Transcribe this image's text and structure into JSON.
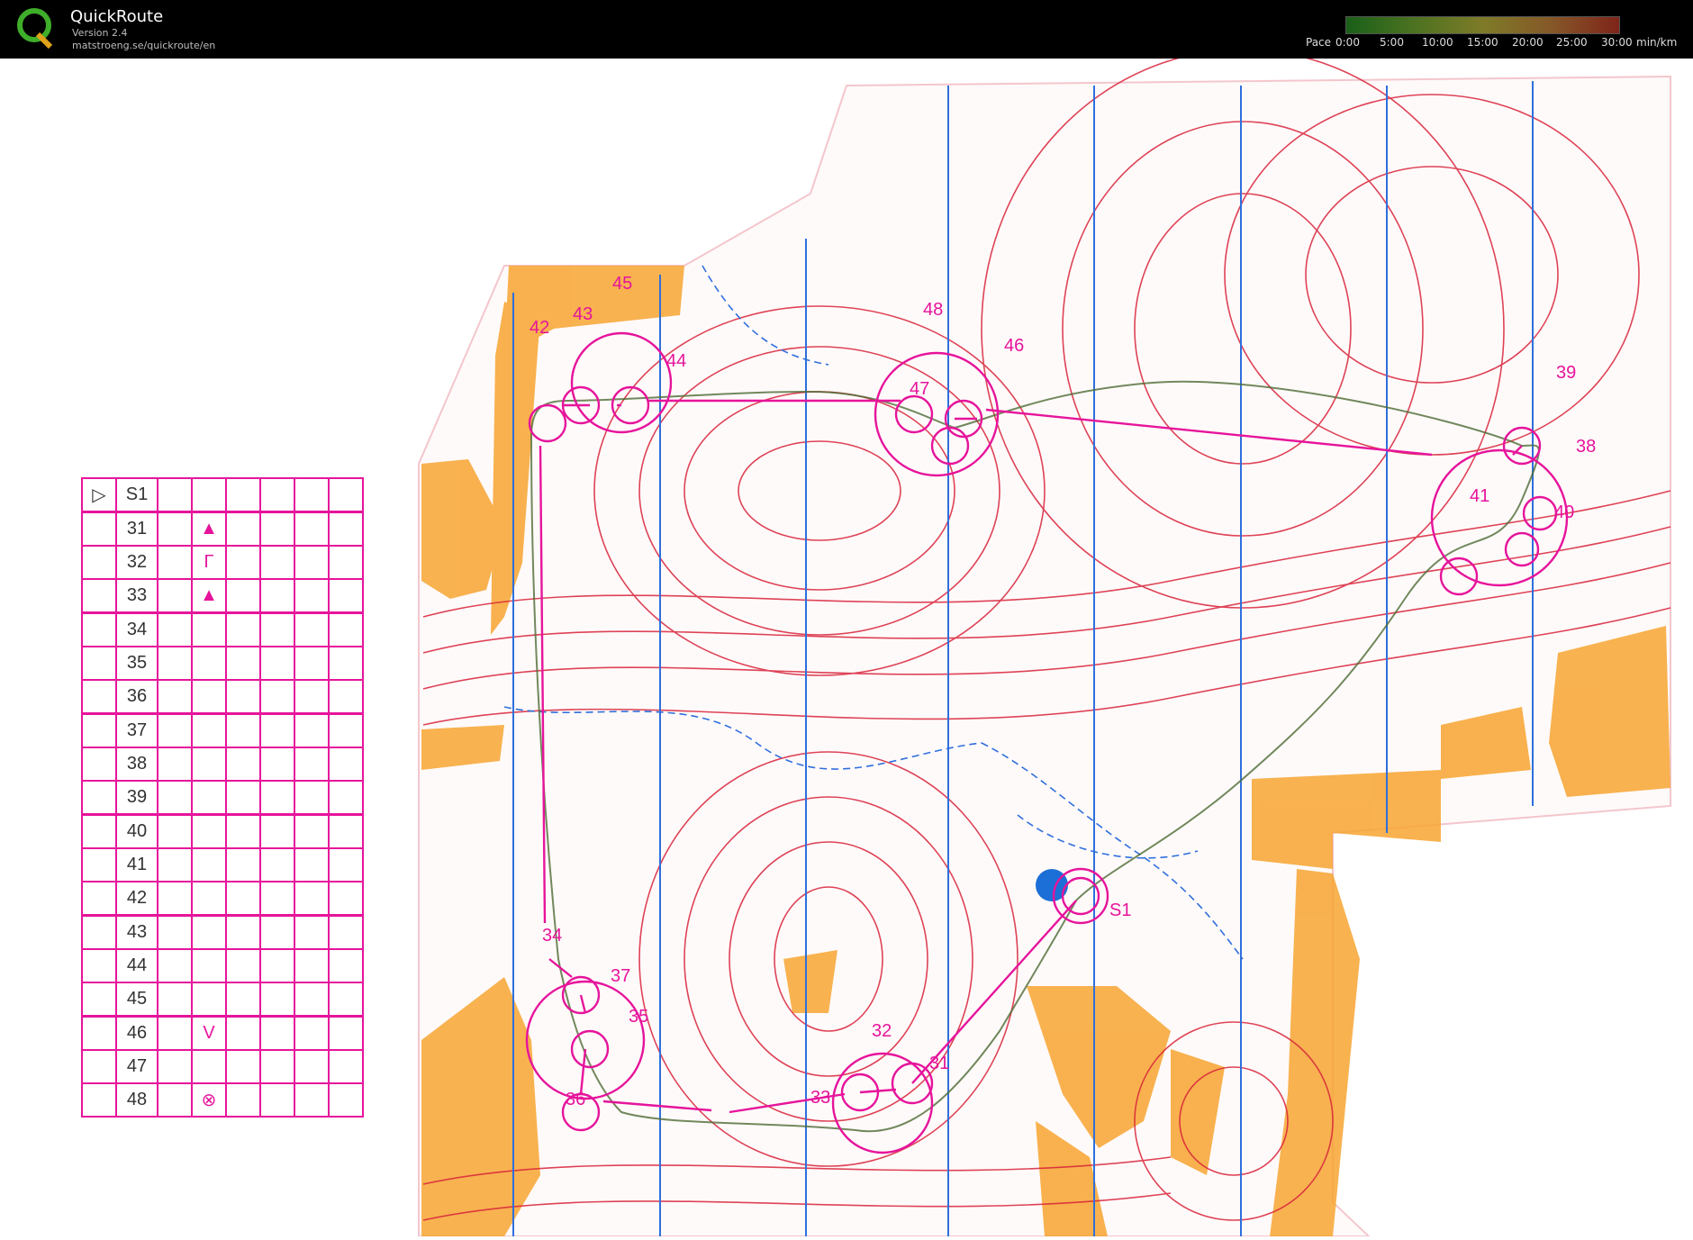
{
  "app": {
    "title": "QuickRoute",
    "version": "Version 2.4",
    "url": "matstroeng.se/quickroute/en",
    "logo_letter": "Q"
  },
  "pace_legend": {
    "label": "Pace",
    "ticks": [
      "0:00",
      "5:00",
      "10:00",
      "15:00",
      "20:00",
      "25:00",
      "30:00"
    ],
    "unit": "min/km"
  },
  "control_description": {
    "start": "S1",
    "rows": [
      {
        "code": "31",
        "symbol": "▲"
      },
      {
        "code": "32",
        "symbol": "Γ"
      },
      {
        "code": "33",
        "symbol": "▲"
      },
      {
        "code": "34",
        "symbol": ""
      },
      {
        "code": "35",
        "symbol": ""
      },
      {
        "code": "36",
        "symbol": ""
      },
      {
        "code": "37",
        "symbol": ""
      },
      {
        "code": "38",
        "symbol": ""
      },
      {
        "code": "39",
        "symbol": ""
      },
      {
        "code": "40",
        "symbol": ""
      },
      {
        "code": "41",
        "symbol": ""
      },
      {
        "code": "42",
        "symbol": ""
      },
      {
        "code": "43",
        "symbol": ""
      },
      {
        "code": "44",
        "symbol": ""
      },
      {
        "code": "45",
        "symbol": ""
      },
      {
        "code": "46",
        "symbol": "V"
      },
      {
        "code": "47",
        "symbol": ""
      },
      {
        "code": "48",
        "symbol": "⊗"
      }
    ]
  },
  "controls": [
    {
      "label": "S1"
    },
    {
      "label": "31"
    },
    {
      "label": "32"
    },
    {
      "label": "33"
    },
    {
      "label": "34"
    },
    {
      "label": "35"
    },
    {
      "label": "36"
    },
    {
      "label": "37"
    },
    {
      "label": "38"
    },
    {
      "label": "39"
    },
    {
      "label": "40"
    },
    {
      "label": "41"
    },
    {
      "label": "42"
    },
    {
      "label": "43"
    },
    {
      "label": "44"
    },
    {
      "label": "45"
    },
    {
      "label": "46"
    },
    {
      "label": "47"
    },
    {
      "label": "48"
    }
  ],
  "colors": {
    "course": "#e6149b",
    "contour": "#d8243a",
    "north_lines": "#2f6fdc",
    "open_land": "#f7a531",
    "water": "#1c6fd6",
    "route": "#3a3a3a"
  }
}
